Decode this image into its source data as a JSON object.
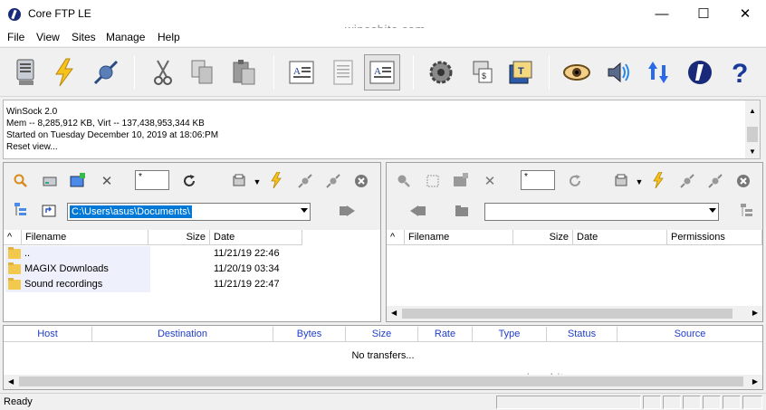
{
  "window": {
    "title": "Core FTP LE",
    "watermark": "winosbite.com",
    "minimize": "—",
    "maximize": "☐",
    "close": "✕"
  },
  "menu": [
    "File",
    "View",
    "Sites",
    "Manage",
    "Help"
  ],
  "toolbar": [
    "connect-icon",
    "quick-connect-icon",
    "disconnect-icon",
    "cut-icon",
    "copy-icon",
    "paste-icon",
    "view-icon",
    "edit-icon",
    "log-icon",
    "settings-icon",
    "site-manager-icon",
    "terminal-icon",
    "eye-icon",
    "sound-icon",
    "transfer-icon",
    "core-logo-icon",
    "help-icon"
  ],
  "log": {
    "lines": [
      "WinSock 2.0",
      "Mem -- 8,285,912 KB, Virt -- 137,438,953,344 KB",
      "Started on Tuesday December 10, 2019 at 18:06:PM",
      "Reset view..."
    ]
  },
  "local": {
    "filter": "*",
    "path": "C:\\Users\\asus\\Documents\\",
    "columns": [
      "^",
      "Filename",
      "Size",
      "Date"
    ],
    "rows": [
      {
        "name": "..",
        "size": "",
        "date": "11/21/19  22:46"
      },
      {
        "name": "MAGIX Downloads",
        "size": "",
        "date": "11/20/19  03:34"
      },
      {
        "name": "Sound recordings",
        "size": "",
        "date": "11/21/19  22:47"
      }
    ]
  },
  "remote": {
    "filter": "*",
    "path": "",
    "columns": [
      "^",
      "Filename",
      "Size",
      "Date",
      "Permissions"
    ]
  },
  "transfers": {
    "columns": [
      "Host",
      "Destination",
      "Bytes",
      "Size",
      "Rate",
      "Type",
      "Status",
      "Source"
    ],
    "empty": "No transfers...",
    "watermark": "winosbite.com"
  },
  "status": {
    "text": "Ready"
  }
}
